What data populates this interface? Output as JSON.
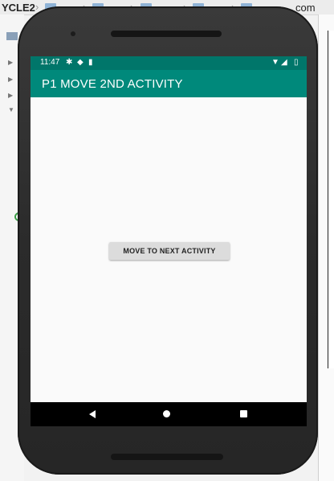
{
  "ide": {
    "breadcrumb_project": "YCLE2",
    "breadcrumb_last": "com"
  },
  "statusbar": {
    "time": "11:47"
  },
  "app": {
    "title": "P1 MOVE 2ND ACTIVITY",
    "button_label": "MOVE TO NEXT ACTIVITY"
  },
  "icons": {
    "status_left": [
      "settings-icon",
      "shield-icon",
      "sd-card-icon"
    ],
    "status_right": [
      "wifi-icon",
      "signal-icon",
      "battery-icon"
    ],
    "nav": [
      "back-icon",
      "home-icon",
      "recents-icon"
    ]
  },
  "colors": {
    "status_bar": "#00766a",
    "app_bar": "#00897b",
    "button": "#dcdcdc"
  }
}
